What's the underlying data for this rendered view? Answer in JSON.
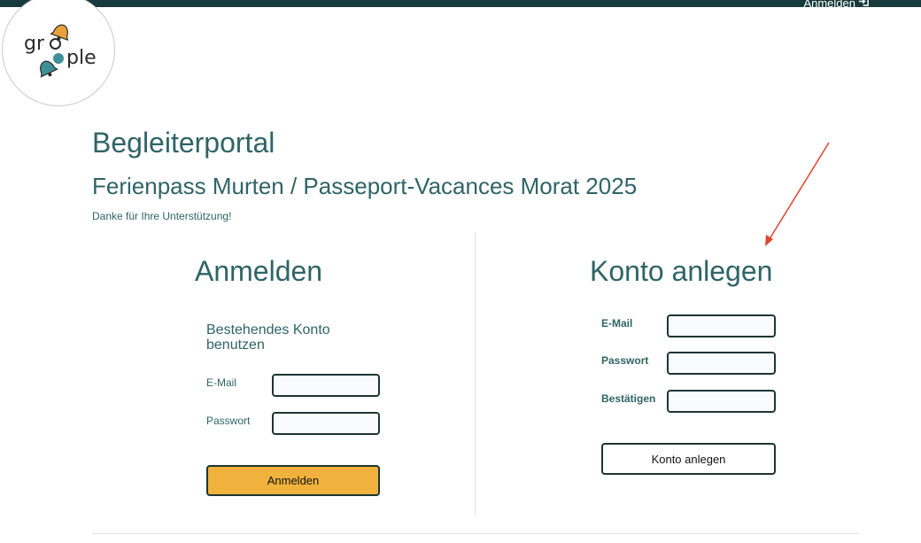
{
  "topbar": {
    "login_label": "Anmelden",
    "icon": "sign-in-icon"
  },
  "logo": {
    "text": "groople",
    "colors": [
      "#e8a23a",
      "#3e8f98",
      "#2b2b2b"
    ]
  },
  "header": {
    "title": "Begleiterportal",
    "subtitle": "Ferienpass Murten / Passeport-Vacances Morat 2025",
    "thanks": "Danke für Ihre Unterstützung!"
  },
  "login": {
    "title": "Anmelden",
    "heading": "Bestehendes Konto benutzen",
    "email_label": "E-Mail",
    "password_label": "Passwort",
    "submit_label": "Anmelden"
  },
  "register": {
    "title": "Konto anlegen",
    "email_label": "E-Mail",
    "password_label": "Passwort",
    "confirm_label": "Bestätigen",
    "submit_label": "Konto anlegen"
  },
  "colors": {
    "topbar": "#173b3d",
    "text": "#2f6467",
    "primary_button": "#f0b23c",
    "annotation_arrow": "#e0442c"
  }
}
